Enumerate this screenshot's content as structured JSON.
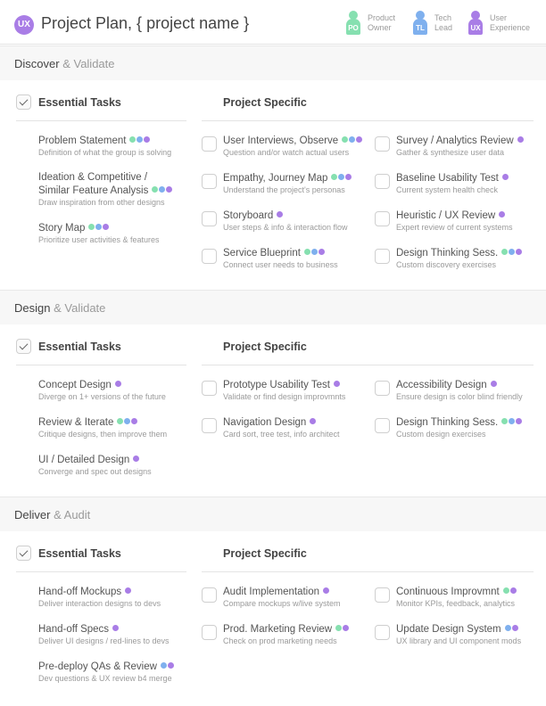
{
  "header": {
    "badge": "UX",
    "title": "Project Plan, { project name }",
    "legend": [
      {
        "code": "PO",
        "line1": "Product",
        "line2": "Owner",
        "color": "#86e0b0"
      },
      {
        "code": "TL",
        "line1": "Tech",
        "line2": "Lead",
        "color": "#7fb0ee"
      },
      {
        "code": "UX",
        "line1": "User",
        "line2": "Experience",
        "color": "#a97de6"
      }
    ]
  },
  "columns": {
    "essential": "Essential Tasks",
    "specific": "Project Specific"
  },
  "sections": [
    {
      "title_strong": "Discover",
      "title_light": "& Validate",
      "essential": [
        {
          "name": "Problem Statement",
          "desc": "Definition of what the group is solving",
          "roles": [
            "po",
            "tl",
            "ux"
          ]
        },
        {
          "name": "Ideation & Competitive /",
          "name2": "Similar Feature Analysis",
          "desc": "Draw inspiration from other designs",
          "roles": [
            "po",
            "tl",
            "ux"
          ]
        },
        {
          "name": "Story Map",
          "desc": "Prioritize user activities & features",
          "roles": [
            "po",
            "tl",
            "ux"
          ]
        }
      ],
      "specific_left": [
        {
          "name": "User Interviews, Observe",
          "desc": "Question and/or watch actual users",
          "roles": [
            "po",
            "tl",
            "ux"
          ]
        },
        {
          "name": "Empathy, Journey Map",
          "desc": "Understand the project's personas",
          "roles": [
            "po",
            "tl",
            "ux"
          ]
        },
        {
          "name": "Storyboard",
          "desc": "User steps & info & interaction flow",
          "roles": [
            "ux"
          ]
        },
        {
          "name": "Service Blueprint",
          "desc": "Connect user needs to business",
          "roles": [
            "po",
            "tl",
            "ux"
          ]
        }
      ],
      "specific_right": [
        {
          "name": "Survey / Analytics Review",
          "desc": "Gather & synthesize user data",
          "roles": [
            "ux"
          ]
        },
        {
          "name": "Baseline Usability Test",
          "desc": "Current system health check",
          "roles": [
            "ux"
          ]
        },
        {
          "name": "Heuristic / UX Review",
          "desc": "Expert review of current systems",
          "roles": [
            "ux"
          ]
        },
        {
          "name": "Design Thinking Sess.",
          "desc": "Custom discovery exercises",
          "roles": [
            "po",
            "tl",
            "ux"
          ]
        }
      ]
    },
    {
      "title_strong": "Design",
      "title_light": "& Validate",
      "essential": [
        {
          "name": "Concept Design",
          "desc": "Diverge on 1+ versions of the future",
          "roles": [
            "ux"
          ]
        },
        {
          "name": "Review & Iterate",
          "desc": "Critique designs, then improve them",
          "roles": [
            "po",
            "tl",
            "ux"
          ]
        },
        {
          "name": "UI / Detailed Design",
          "desc": "Converge and spec out designs",
          "roles": [
            "ux"
          ]
        }
      ],
      "specific_left": [
        {
          "name": "Prototype Usability Test",
          "desc": "Validate or find design improvmnts",
          "roles": [
            "ux"
          ]
        },
        {
          "name": "Navigation Design",
          "desc": "Card sort, tree test, info architect",
          "roles": [
            "ux"
          ]
        }
      ],
      "specific_right": [
        {
          "name": "Accessibility Design",
          "desc": "Ensure design is color blind friendly",
          "roles": [
            "ux"
          ]
        },
        {
          "name": "Design Thinking Sess.",
          "desc": "Custom design exercises",
          "roles": [
            "po",
            "tl",
            "ux"
          ]
        }
      ]
    },
    {
      "title_strong": "Deliver",
      "title_light": "& Audit",
      "essential": [
        {
          "name": "Hand-off Mockups",
          "desc": "Deliver interaction designs to devs",
          "roles": [
            "ux"
          ]
        },
        {
          "name": "Hand-off Specs",
          "desc": "Deliver UI designs / red-lines to devs",
          "roles": [
            "ux"
          ]
        },
        {
          "name": "Pre-deploy QAs & Review",
          "desc": "Dev questions & UX review b4 merge",
          "roles": [
            "tl",
            "ux"
          ]
        }
      ],
      "specific_left": [
        {
          "name": "Audit Implementation",
          "desc": "Compare mockups w/live system",
          "roles": [
            "ux"
          ]
        },
        {
          "name": "Prod. Marketing Review",
          "desc": "Check on prod marketing needs",
          "roles": [
            "po",
            "ux"
          ]
        }
      ],
      "specific_right": [
        {
          "name": "Continuous Improvmnt",
          "desc": "Monitor KPIs, feedback, analytics",
          "roles": [
            "po",
            "ux"
          ]
        },
        {
          "name": "Update Design System",
          "desc": "UX library and UI component mods",
          "roles": [
            "tl",
            "ux"
          ]
        }
      ]
    }
  ]
}
